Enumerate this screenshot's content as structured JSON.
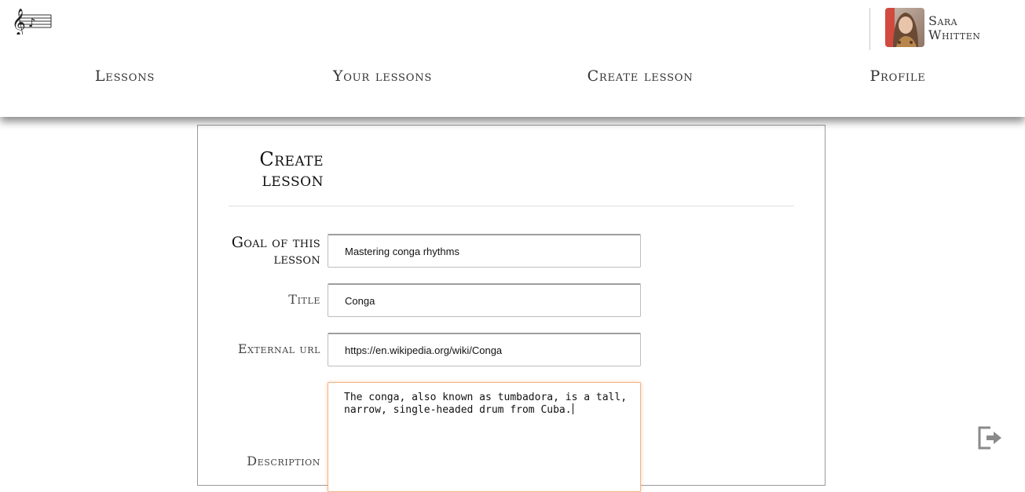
{
  "user": {
    "first_name": "Sara",
    "last_name": "Whitten"
  },
  "nav": [
    {
      "label": "Lessons"
    },
    {
      "label": "Your lessons"
    },
    {
      "label": "Create lesson"
    },
    {
      "label": "Profile"
    }
  ],
  "form": {
    "title": "Create lesson",
    "fields": {
      "goal": {
        "label": "Goal of this lesson",
        "value": "Mastering conga rhythms"
      },
      "title": {
        "label": "Title",
        "value": "Conga"
      },
      "url": {
        "label": "External url",
        "value": "https://en.wikipedia.org/wiki/Conga"
      },
      "description": {
        "label": "Description",
        "value": "The conga, also known as tumbadora, is a tall, narrow, single-headed drum from Cuba."
      }
    }
  },
  "icons": {
    "logo": "music-staff-logo",
    "logout": "logout-icon"
  },
  "colors": {
    "focus_border": "#f2b48a",
    "icon_gray": "#8a8a8a"
  }
}
